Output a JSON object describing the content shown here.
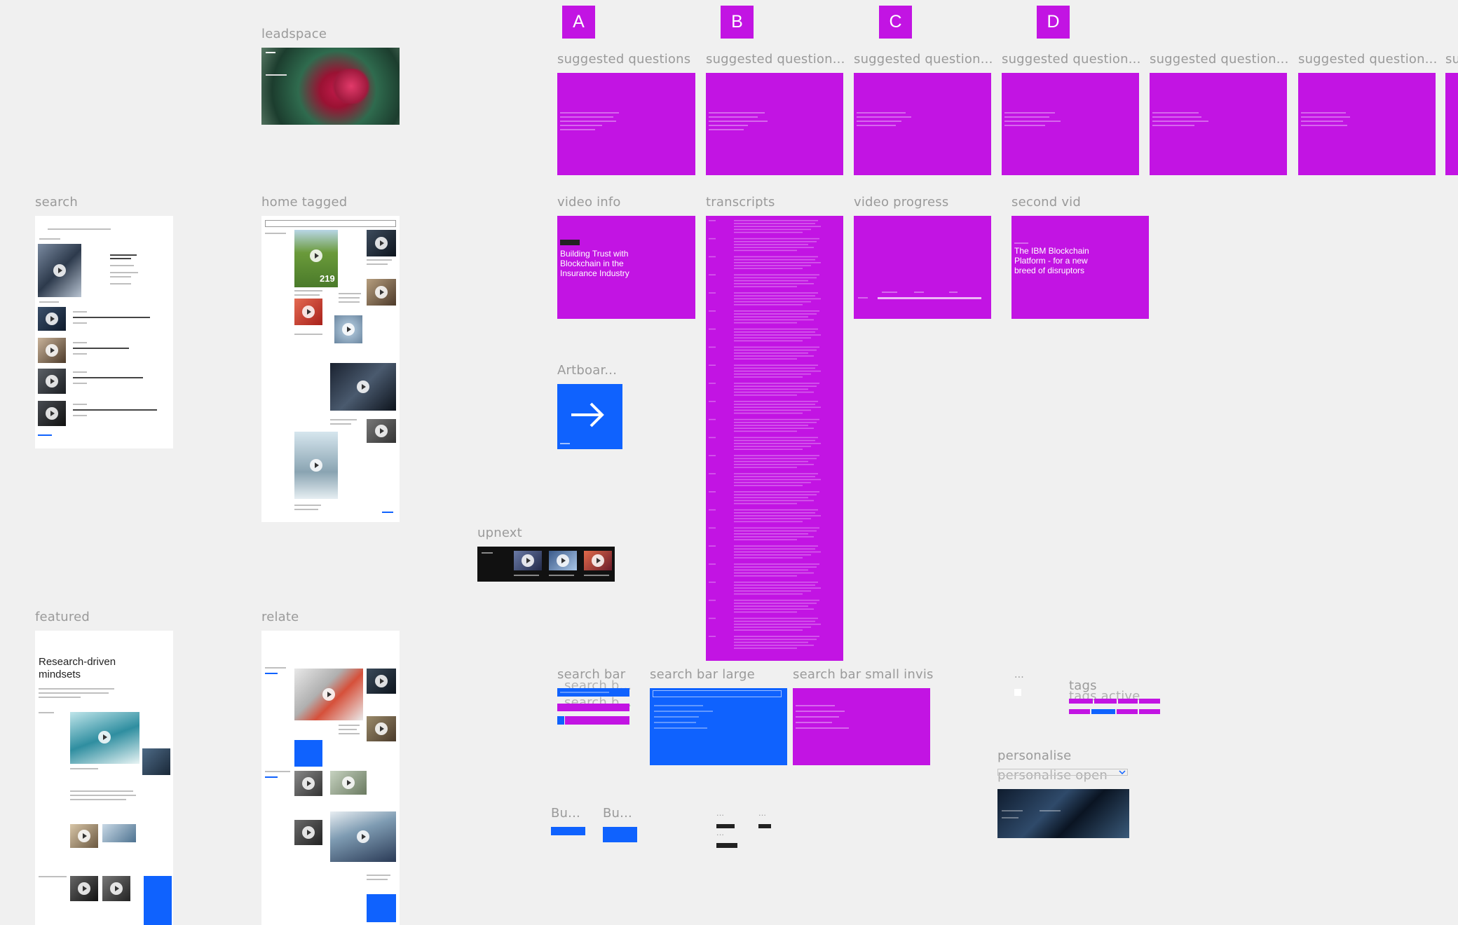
{
  "labels": {
    "leadspace": "leadspace",
    "search": "search",
    "home_tagged": "home tagged",
    "featured": "featured",
    "relate": "relate",
    "upnext": "upnext",
    "suggested": [
      "suggested questions",
      "suggested question...",
      "suggested question...",
      "suggested question...",
      "suggested question...",
      "suggested question...",
      "su"
    ],
    "video_info": "video info",
    "transcripts": "transcripts",
    "video_progress": "video progress",
    "second_vid": "second vid",
    "artboard": "Artboar...",
    "search_bar": "search bar",
    "search_b_1": "search b...",
    "search_b_2": "search b...",
    "search_bar_large": "search bar large",
    "search_bar_small_invis": "search bar small invis",
    "tags": "tags",
    "tags_active": "tags active",
    "personalise": "personalise",
    "personalise_open": "personalise open",
    "ellipsis": "...",
    "bu_1": "Bu...",
    "bu_2": "Bu..."
  },
  "badges": [
    "A",
    "B",
    "C",
    "D"
  ],
  "video_info": {
    "title": "Building Trust with Blockchain in the Insurance Industry"
  },
  "second_vid": {
    "title": "The IBM Blockchain Platform - for a new breed of disruptors"
  },
  "featured": {
    "title": "Research-driven mindsets"
  },
  "home_tagged": {
    "count": "219"
  },
  "colors": {
    "canvas": "#f0f0f0",
    "magenta": "#c214e3",
    "ibm_blue": "#0f62fe",
    "label_gray": "#9a9a9a"
  },
  "icons": [
    "arrow-right-icon",
    "play-icon",
    "search-icon",
    "chevron-down-icon"
  ]
}
